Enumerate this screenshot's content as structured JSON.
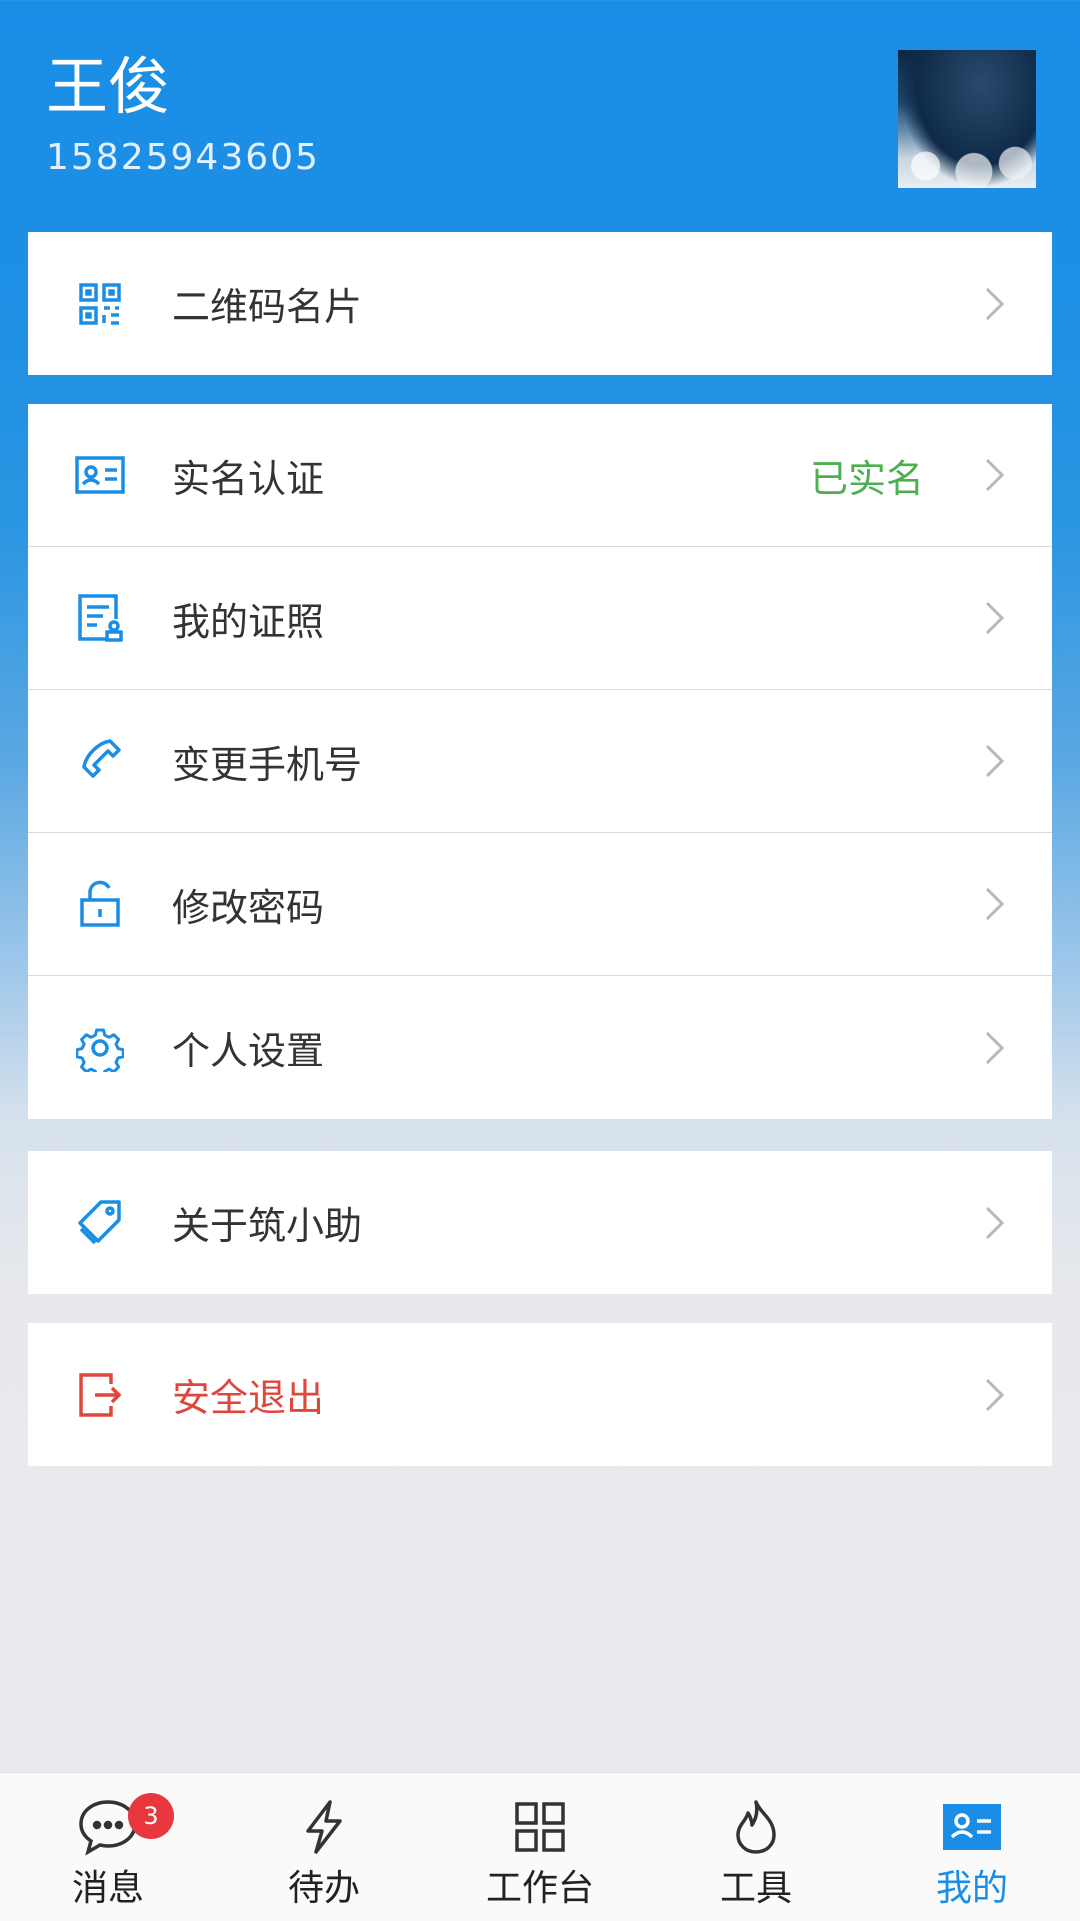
{
  "user": {
    "name": "王俊",
    "phone": "15825943605"
  },
  "menu": {
    "qrcode": {
      "label": "二维码名片",
      "icon": "qrcode-icon"
    },
    "realname": {
      "label": "实名认证",
      "value": "已实名",
      "icon": "id-card-icon"
    },
    "certs": {
      "label": "我的证照",
      "icon": "certificate-icon"
    },
    "phone": {
      "label": "变更手机号",
      "icon": "phone-icon"
    },
    "password": {
      "label": "修改密码",
      "icon": "unlock-icon"
    },
    "settings": {
      "label": "个人设置",
      "icon": "gear-icon"
    },
    "about": {
      "label": "关于筑小助",
      "icon": "tag-icon"
    },
    "logout": {
      "label": "安全退出",
      "icon": "logout-icon"
    }
  },
  "tabbar": {
    "tabs": [
      {
        "label": "消息",
        "icon": "chat-bubble-icon",
        "badge": "3"
      },
      {
        "label": "待办",
        "icon": "lightning-icon"
      },
      {
        "label": "工作台",
        "icon": "grid-icon"
      },
      {
        "label": "工具",
        "icon": "flame-icon"
      },
      {
        "label": "我的",
        "icon": "profile-card-icon",
        "active": true
      }
    ]
  },
  "colors": {
    "primary": "#1a8ee6",
    "verified": "#4caf50",
    "danger": "#e0473c",
    "badge": "#e8383d"
  }
}
